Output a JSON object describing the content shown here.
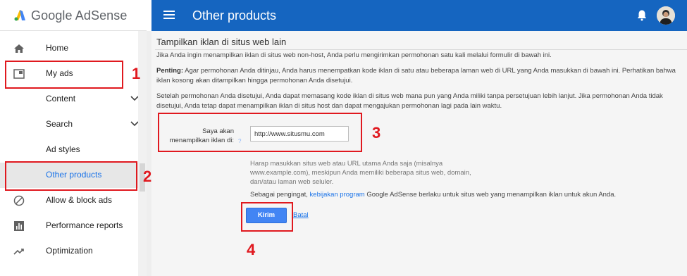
{
  "sidebar": {
    "logo_text": "Google AdSense",
    "items": [
      {
        "label": "Home",
        "icon": "home-icon"
      },
      {
        "label": "My ads",
        "icon": "ad-unit-icon"
      },
      {
        "label": "Content",
        "icon": "chevron-down-icon"
      },
      {
        "label": "Search",
        "icon": "chevron-down-icon"
      },
      {
        "label": "Ad styles"
      },
      {
        "label": "Other products"
      },
      {
        "label": "Allow & block ads",
        "icon": "block-icon"
      },
      {
        "label": "Performance reports",
        "icon": "bar-chart-icon"
      },
      {
        "label": "Optimization",
        "icon": "trending-up-icon"
      }
    ]
  },
  "topbar": {
    "title": "Other products"
  },
  "main": {
    "heading": "Tampilkan iklan di situs web lain",
    "intro": "Jika Anda ingin menampilkan iklan di situs web non-host, Anda perlu mengirimkan permohonan satu kali melalui formulir di bawah ini.",
    "important_label": "Penting:",
    "important_text": " Agar permohonan Anda ditinjau, Anda harus menempatkan kode iklan di satu atau beberapa laman web di URL yang Anda masukkan di bawah ini. Perhatikan bahwa iklan kosong akan ditampilkan hingga permohonan Anda disetujui.",
    "after_text": "Setelah permohonan Anda disetujui, Anda dapat memasang kode iklan di situs web mana pun yang Anda miliki tanpa persetujuan lebih lanjut. Jika permohonan Anda tidak disetujui, Anda tetap dapat menampilkan iklan di situs host dan dapat mengajukan permohonan lagi pada lain waktu.",
    "form_label": "Saya akan menampilkan iklan di:",
    "help_mark": "?",
    "url_value": "http://www.situsmu.com",
    "hint": "Harap masukkan situs web atau URL utama Anda saja (misalnya www.example.com), meskipun Anda memiliki beberapa situs web, domain, dan/atau laman web seluler.",
    "reminder_prefix": "Sebagai pengingat, ",
    "reminder_link": "kebijakan program",
    "reminder_suffix": " Google AdSense berlaku untuk situs web yang menampilkan iklan untuk akun Anda.",
    "submit_label": "Kirim",
    "cancel_label": "Batal"
  },
  "annotations": [
    "1",
    "2",
    "3",
    "4"
  ],
  "colors": {
    "brand_blue": "#1565c0",
    "annotation_red": "#e0191f",
    "link_blue": "#1a73e8",
    "button_blue": "#4285f4"
  }
}
